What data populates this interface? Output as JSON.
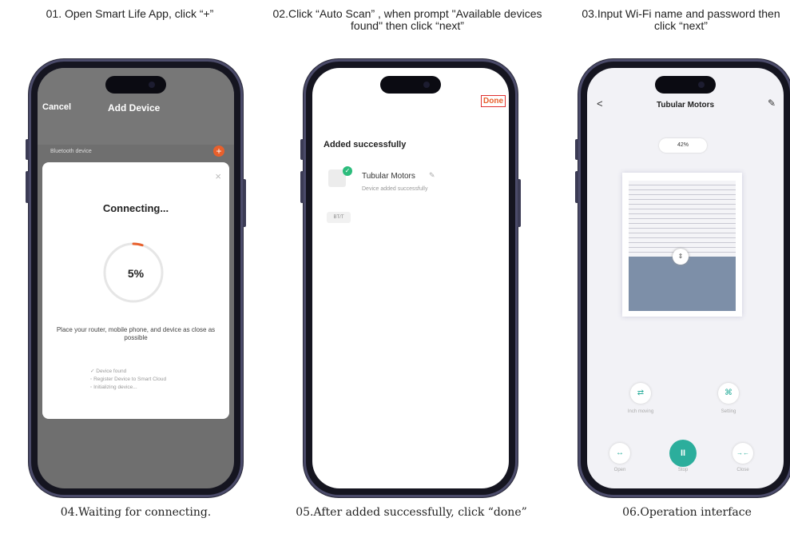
{
  "captions": {
    "step1": "01. Open Smart Life App, click “+”",
    "step2": "02.Click “Auto Scan” , when prompt \"Available devices found\" then click “next”",
    "step3": "03.Input Wi-Fi name and password then click “next”",
    "step4": "04.Waiting for connecting.",
    "step5": "05.After added successfully, click “done”",
    "step6": "06.Operation interface"
  },
  "phone1": {
    "cancel": "Cancel",
    "title": "Add Device",
    "bluetooth": "Bluetooth device",
    "plus": "+",
    "close": "×",
    "connecting": "Connecting...",
    "progress_label": "5%",
    "progress": 0.05,
    "tip": "Place your router, mobile phone, and device as close as possible",
    "steps": [
      "✓ Device found",
      "◦ Register Device to Smart Cloud",
      "◦ Initializing device..."
    ]
  },
  "phone2": {
    "done": "Done",
    "added": "Added successfully",
    "device_name": "Tubular Motors",
    "device_sub": "Device added successfully",
    "room": "BT/T",
    "check": "✓",
    "pen": "✎"
  },
  "phone3": {
    "back": "<",
    "title": "Tubular Motors",
    "edit": "✎",
    "percent": "42%",
    "open_level": 0.42,
    "handle": "⇕",
    "inch_icon": "⇄",
    "inch_label": "Inch moving",
    "setting_icon": "⌘",
    "setting_label": "Setting",
    "open_icon": "↔",
    "open_label": "Open",
    "stop_icon": "II",
    "stop_label": "Stop",
    "close_icon": "→←",
    "close_label": "Close"
  },
  "colors": {
    "accent": "#e8602c",
    "teal": "#2cae9c",
    "success": "#2cbc7c"
  }
}
